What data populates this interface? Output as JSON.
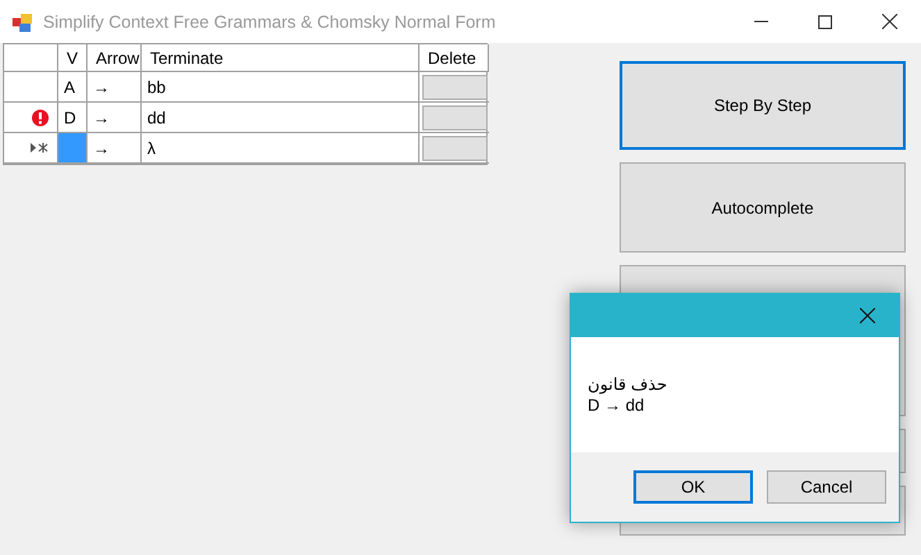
{
  "window": {
    "title": "Simplify Context Free Grammars & Chomsky Normal Form"
  },
  "table": {
    "columns": [
      "V",
      "Arrow",
      "Terminate",
      "Delete"
    ],
    "rows": [
      {
        "v": "A",
        "arrow": "→",
        "terminate": "bb",
        "error": false,
        "new_row": false,
        "selected": false
      },
      {
        "v": "D",
        "arrow": "→",
        "terminate": "dd",
        "error": true,
        "new_row": false,
        "selected": false
      },
      {
        "arrow": "→",
        "terminate": "λ",
        "error": false,
        "new_row": true,
        "selected": true
      }
    ]
  },
  "buttons": [
    {
      "label": "Step By Step",
      "focused": true
    },
    {
      "label": "Autocomplete",
      "focused": false
    },
    {
      "focused": false
    },
    {
      "focused": false
    },
    {
      "focused": false
    }
  ],
  "dialog": {
    "lines": [
      "حذف قانون",
      "D → dd"
    ],
    "buttons": [
      {
        "label": "OK",
        "focused": true
      },
      {
        "label": "Cancel",
        "focused": false
      }
    ]
  }
}
